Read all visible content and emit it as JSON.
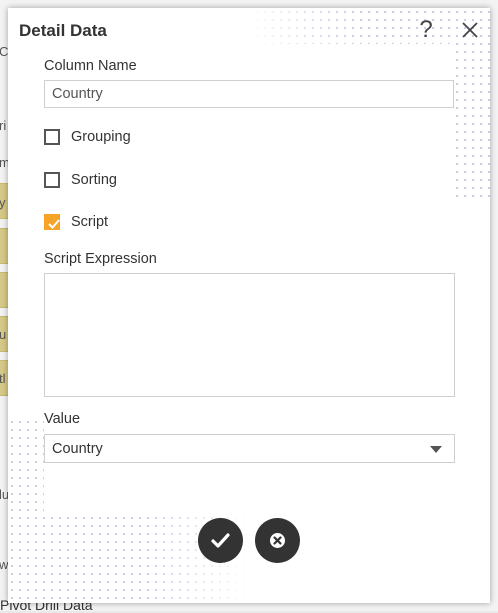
{
  "background": {
    "left_chars": [
      "C",
      "ri",
      "m",
      "y",
      "u",
      "tl",
      "lu",
      "w"
    ],
    "bottom_text": "Pivot Drill Data"
  },
  "dialog": {
    "title": "Detail Data",
    "help_icon": "question-mark-icon",
    "close_icon": "close-icon",
    "column_name_label": "Column Name",
    "column_name_value": "Country",
    "grouping": {
      "label": "Grouping",
      "checked": false
    },
    "sorting": {
      "label": "Sorting",
      "checked": false
    },
    "script": {
      "label": "Script",
      "checked": true
    },
    "script_expression_label": "Script Expression",
    "script_expression_value": "",
    "value_label": "Value",
    "value_selected": "Country",
    "ok_icon": "check-icon",
    "cancel_icon": "cancel-circle-icon"
  },
  "colors": {
    "accent": "#f6a429",
    "button_bg": "#333333",
    "dots": "#c9c6e6"
  }
}
